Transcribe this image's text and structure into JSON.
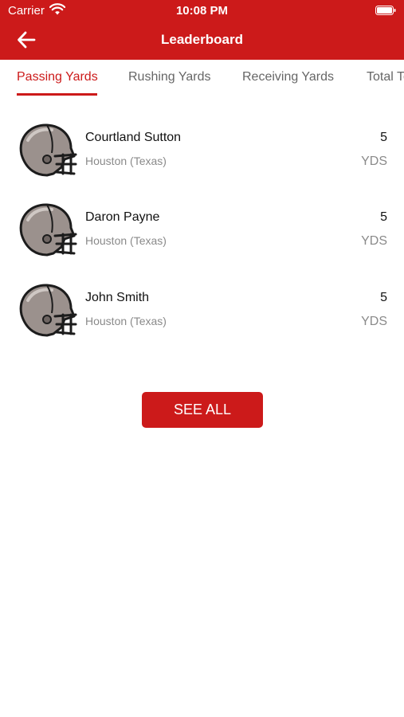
{
  "status_bar": {
    "carrier": "Carrier",
    "time": "10:08 PM"
  },
  "header": {
    "title": "Leaderboard",
    "back_icon": "arrow-left-icon"
  },
  "tabs": [
    {
      "label": "Passing Yards",
      "active": true
    },
    {
      "label": "Rushing Yards",
      "active": false
    },
    {
      "label": "Receiving Yards",
      "active": false
    },
    {
      "label": "Total Touchdowns",
      "active": false
    }
  ],
  "players": [
    {
      "name": "Courtland Sutton",
      "team": "Houston (Texas)",
      "value": "5",
      "unit": "YDS"
    },
    {
      "name": "Daron Payne",
      "team": "Houston (Texas)",
      "value": "5",
      "unit": "YDS"
    },
    {
      "name": "John Smith",
      "team": "Houston (Texas)",
      "value": "5",
      "unit": "YDS"
    }
  ],
  "see_all_label": "SEE ALL",
  "colors": {
    "accent": "#cc1a1a",
    "muted": "#8a8a8a",
    "helmet": "#9b918d"
  }
}
